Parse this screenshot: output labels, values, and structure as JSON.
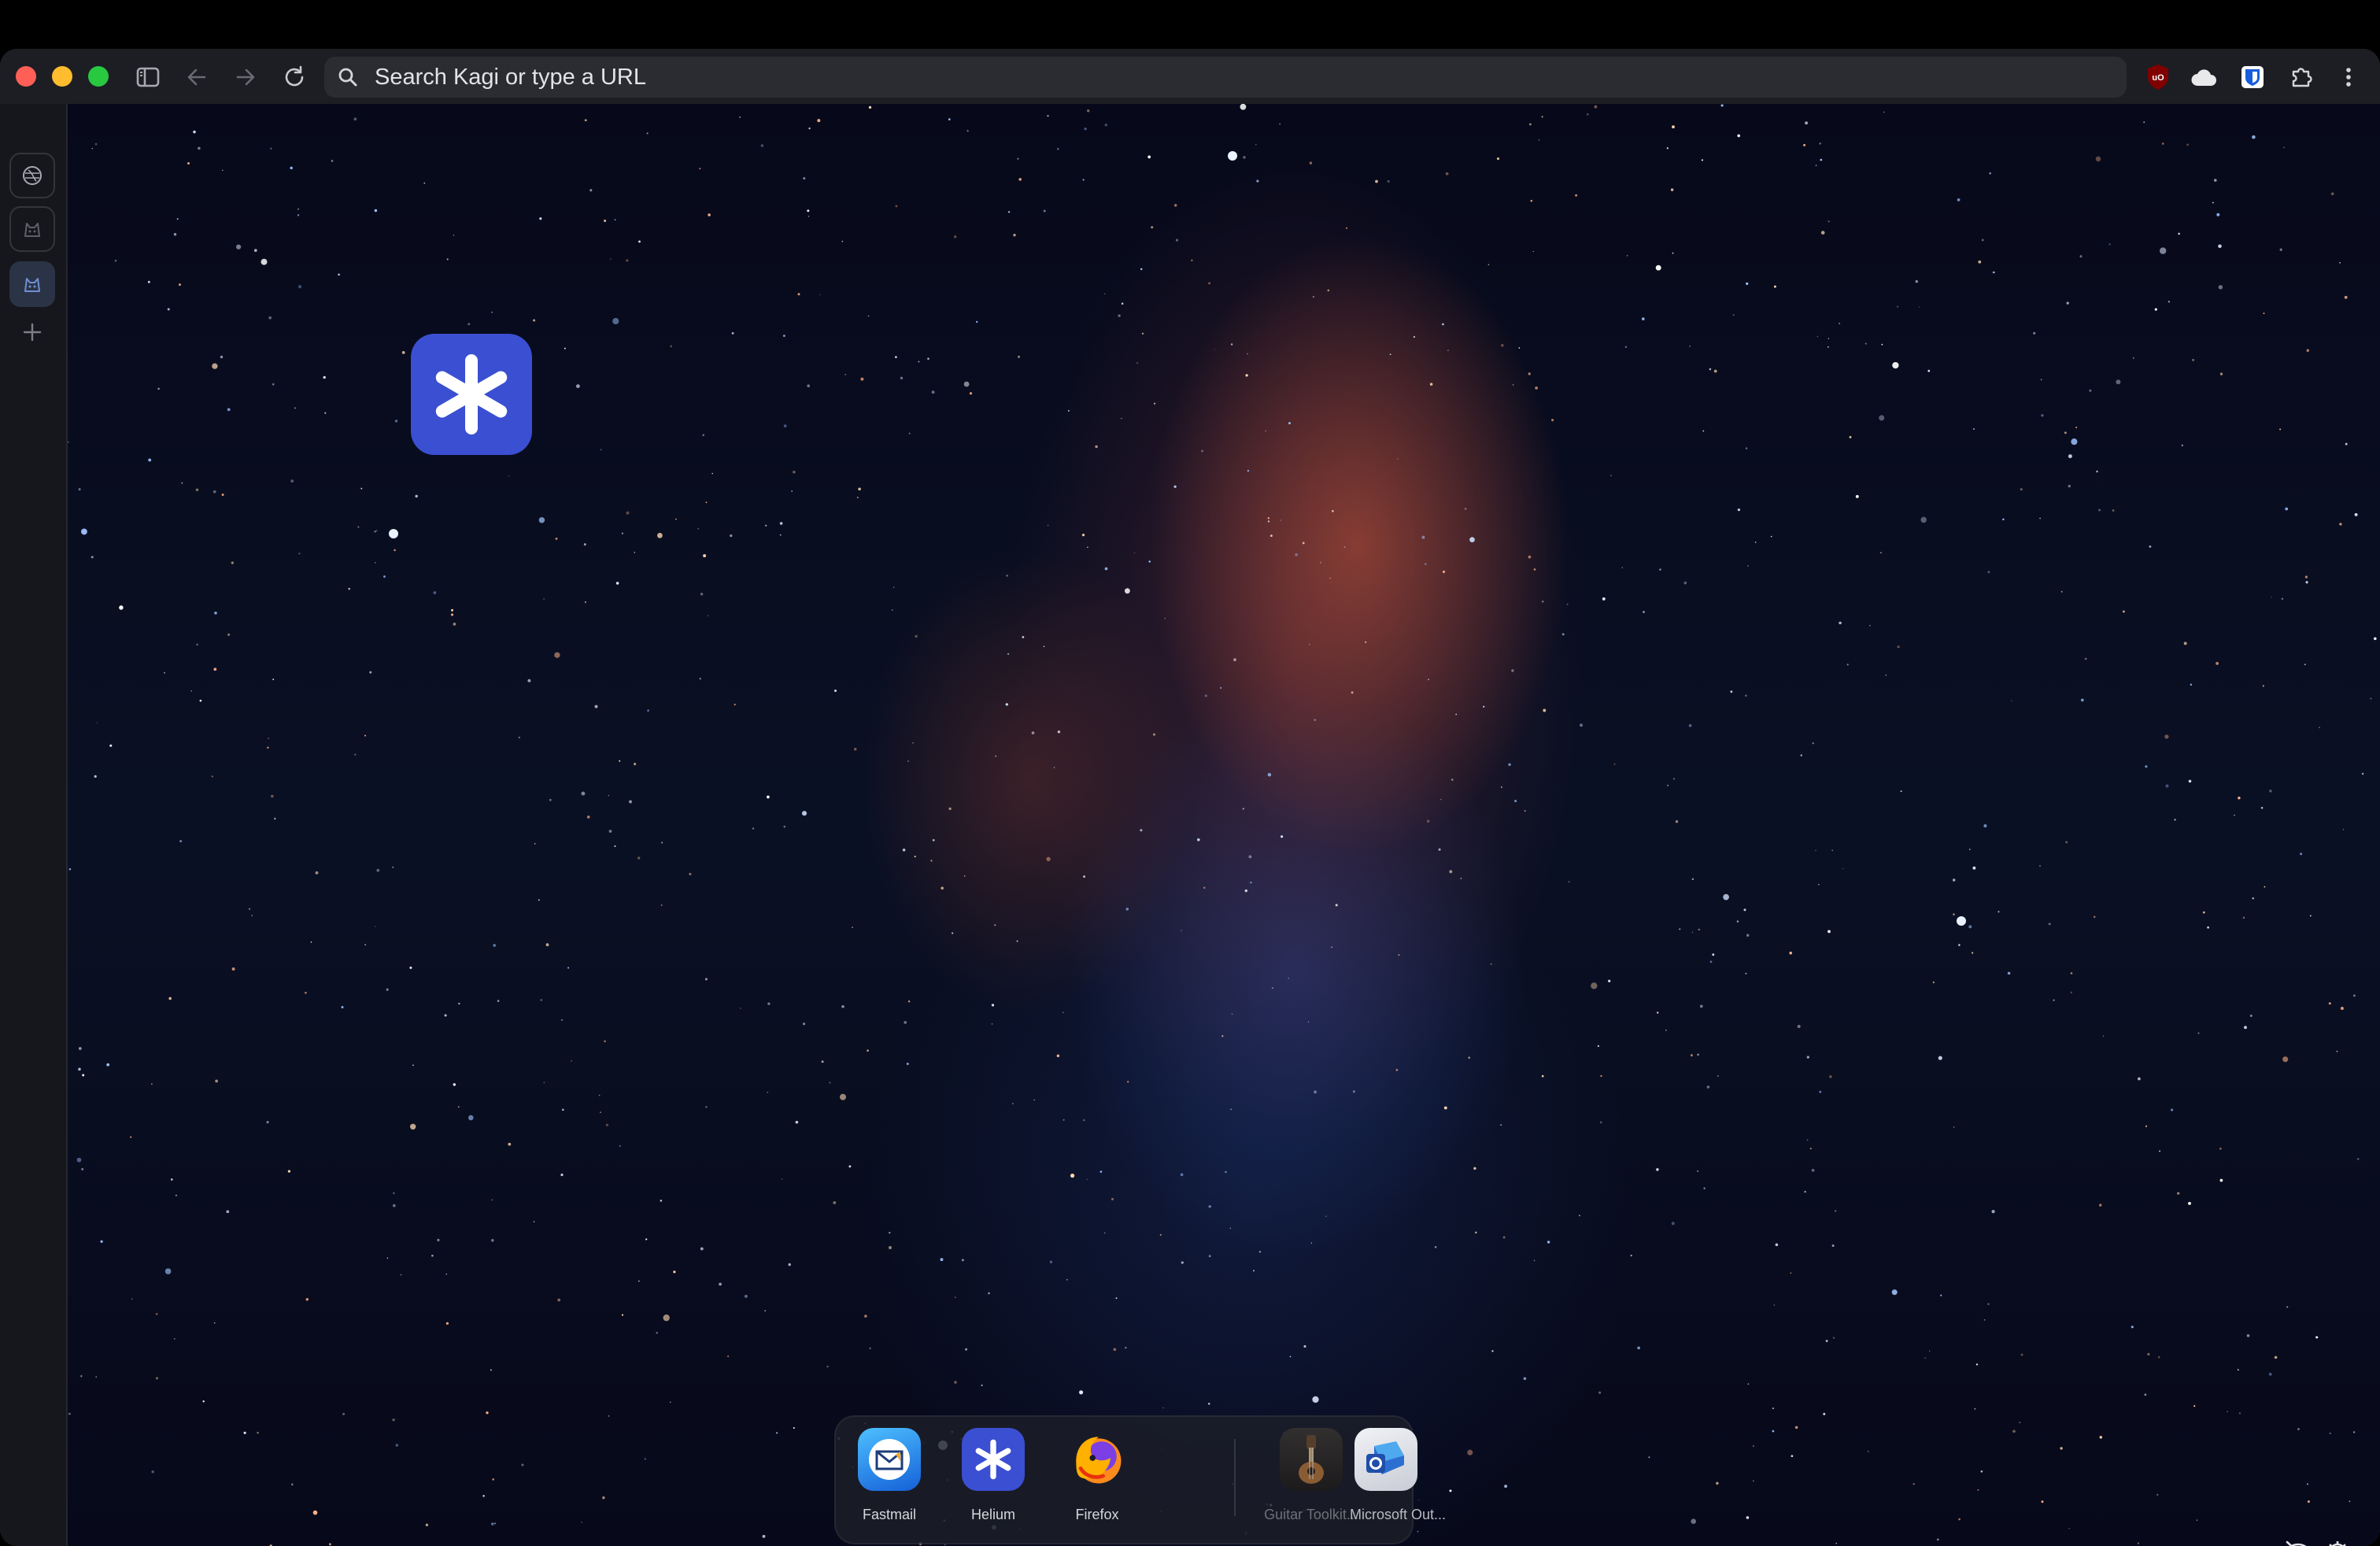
{
  "browser": {
    "address_bar": {
      "placeholder": "Search Kagi or type a URL"
    },
    "extensions": [
      {
        "name": "ublock-origin-icon",
        "label": "uO",
        "color": "#800000"
      },
      {
        "name": "cloud-icon"
      },
      {
        "name": "bitwarden-icon",
        "color": "#175ddc"
      },
      {
        "name": "extensions-puzzle-icon"
      },
      {
        "name": "more-menu-icon"
      }
    ]
  },
  "sidebar": {
    "spaces": [
      {
        "name": "space-1",
        "icon": "space-globe-icon",
        "active": false
      },
      {
        "name": "space-2",
        "icon": "space-cat-icon",
        "active": false
      },
      {
        "name": "space-3",
        "icon": "space-cat-icon",
        "active": true
      }
    ]
  },
  "newtab": {
    "shortcut": {
      "icon": "helium-asterisk-icon",
      "color": "#3a4fd1"
    }
  },
  "dock": {
    "items": [
      {
        "label": "Fastmail",
        "icon": "fastmail-icon"
      },
      {
        "label": "Helium",
        "icon": "helium-icon"
      },
      {
        "label": "Firefox",
        "icon": "firefox-icon"
      },
      {
        "label": "Guitar Toolkit...",
        "icon": "guitar-toolkit-icon"
      },
      {
        "label": "Microsoft Out...",
        "icon": "outlook-icon"
      }
    ]
  },
  "colors": {
    "accent": "#3a4fd1",
    "window_bg": "#16171d",
    "omnibox_bg": "#2b2c32"
  }
}
